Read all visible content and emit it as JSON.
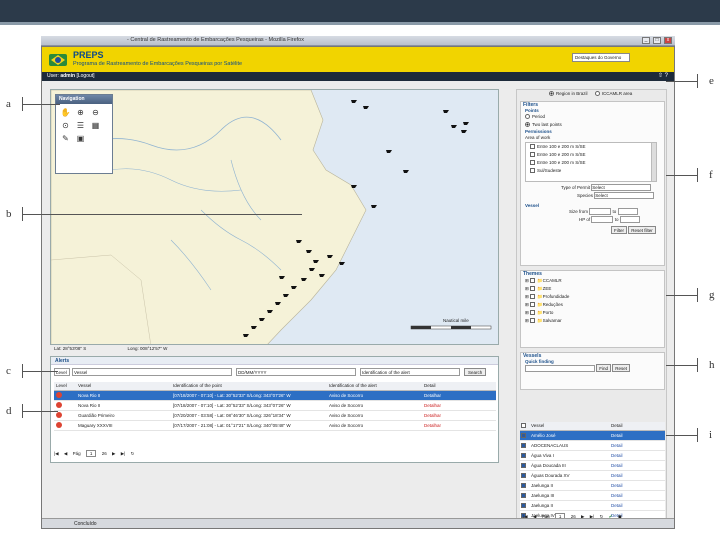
{
  "window": {
    "title": "- Central de Rastreamento de Embarcações Pesqueiras - Mozilla Firefox",
    "controls": [
      "_",
      "□",
      "x"
    ]
  },
  "header": {
    "brand": "PREPS",
    "subtitle": "Programa de Rastreamento de Embarcações Pesqueiras por Satélite",
    "lang_select": "Destaques do Governo"
  },
  "userbar": {
    "user_label": "User:",
    "user_name": "admin",
    "logout": "[Logout]"
  },
  "navigation": {
    "title": "Navigation",
    "tools": [
      "hand-icon",
      "zoom-in-icon",
      "zoom-out-icon",
      "zoom-extent-icon",
      "list-icon",
      "measure-icon",
      "pencil-icon",
      "print-icon"
    ]
  },
  "map": {
    "lat": "Lat: 28°53'08\" S",
    "lon": "Long: 008°12'57\" W",
    "scale_label": "Nautical mile"
  },
  "alerts": {
    "title": "Alerts",
    "level_select": "Level",
    "vessel_label": "Vessel",
    "date_placeholder": "DD/MM/YYYY",
    "ident_label": "Identification of the alert",
    "search": "Search",
    "columns": [
      "Level",
      "Vessel",
      "Identification of the point",
      "Identification of the alert",
      "Detail"
    ],
    "rows": [
      {
        "vessel": "Nova Rio II",
        "point": "[07/18/2007 - 07:10] - Lat: 30°52'33\" S/Long: 343°07'26\" W",
        "alert": "Aviso de Socorro",
        "detail": "Detalhar",
        "selected": true
      },
      {
        "vessel": "Nova Rio II",
        "point": "[07/18/2007 - 07:10] - Lat: 30°52'33\" S/Long: 343°07'26\" W",
        "alert": "Aviso de Socorro",
        "detail": "Detalhar",
        "selected": false
      },
      {
        "vessel": "Guardião Primeiro",
        "point": "[07/20/2007 - 03:58] - Lat: 08°46'30\" S/Long: 326°18'34\" W",
        "alert": "Aviso de Socorro",
        "detail": "Detalhar",
        "selected": false
      },
      {
        "vessel": "Maguary XXXVIII",
        "point": "[07/17/2007 - 21:08] - Lat: 01°17'21\" S/Long: 340°05'48\" W",
        "alert": "Aviso de Socorro",
        "detail": "Detalhar",
        "selected": false
      }
    ],
    "pager": {
      "page_label": "Pág",
      "page": "1",
      "of": "26"
    }
  },
  "sidepanel": {
    "region_radio1": "Region in Brazil",
    "region_radio2": "ICCAMLR area",
    "filters_title": "Filters",
    "points_title": "Points",
    "points_opt1": "Period",
    "points_opt2": "Two last points",
    "permissions_title": "Permissions",
    "area_label": "Area of work",
    "areas": [
      "Entre 100 e 200 m S/SE",
      "Entre 100 e 200 m S/SE",
      "Entre 100 e 200 m S/SE",
      "Sul/Sudeste",
      "Território Nacional"
    ],
    "type_label": "Type of Permit",
    "type_value": "Select",
    "species_label": "Species",
    "species_value": "Select",
    "vessel_title": "Vessel",
    "size_from": "Size from",
    "to": "to",
    "hp_from": "HP of",
    "filter_btn": "Filter",
    "reset_btn": "Reset filter",
    "themes_title": "Themes",
    "themes": [
      "CCAMLR",
      "ZEE",
      "Profundidade",
      "Reduções",
      "Porto",
      "Salvamar"
    ],
    "vessels_title": "Vessels",
    "quick_title": "Quick finding",
    "find_btn": "Find",
    "reset_small": "Reset",
    "vcols": [
      "Vessel",
      "Detail"
    ],
    "vessels": [
      "Amélio José",
      "ADOCENACLAUS",
      "Água Viva I",
      "Água Doucada III",
      "Águas Dourada XV",
      "Jaelunga II",
      "Jaelunga III",
      "Jaelunga II",
      "Jaelunga IV"
    ],
    "vdetail": "Detail",
    "vpager": {
      "page_label": "Pág",
      "page": "1",
      "of": "26"
    }
  },
  "statusbar": {
    "text": "Concluído"
  },
  "callouts": [
    "a",
    "b",
    "c",
    "d",
    "e",
    "f",
    "g",
    "h",
    "i"
  ]
}
